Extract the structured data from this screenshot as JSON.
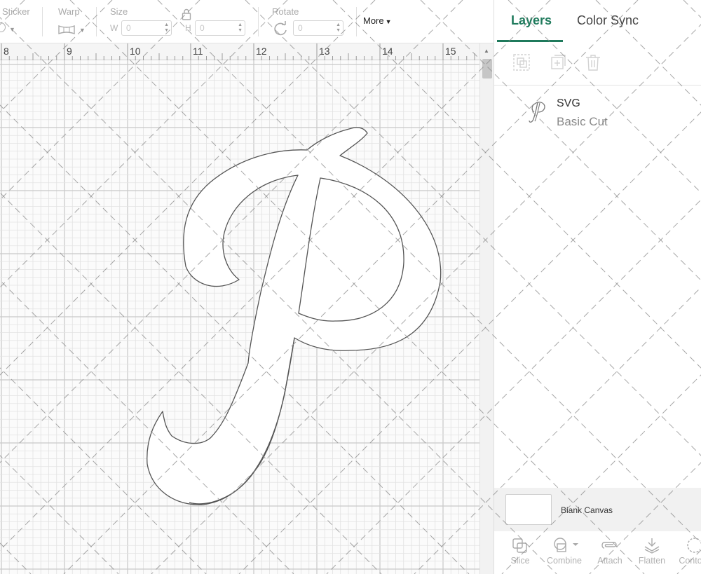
{
  "toolbar": {
    "sticker_label": "Sticker",
    "warp_label": "Warp",
    "size_label": "Size",
    "size_w_letter": "W",
    "size_w_value": "0",
    "size_h_letter": "H",
    "size_h_value": "0",
    "rotate_label": "Rotate",
    "rotate_value": "0",
    "more_label": "More"
  },
  "ruler": {
    "numbers": [
      "8",
      "9",
      "10",
      "11",
      "12",
      "13",
      "14",
      "15"
    ]
  },
  "panel": {
    "tabs": {
      "layers": "Layers",
      "color_sync": "Color Sync",
      "active": "layers"
    },
    "layer_actions": [
      "group-icon",
      "duplicate-icon",
      "delete-icon"
    ],
    "layer": {
      "name": "SVG",
      "operation": "Basic Cut",
      "thumbnail_icon": "script-p-icon"
    },
    "canvas_strip": {
      "label": "Blank Canvas"
    },
    "bottom_tools": {
      "slice": "Slice",
      "combine": "Combine",
      "attach": "Attach",
      "flatten": "Flatten",
      "contour": "Conto"
    }
  },
  "colors": {
    "accent": "#1f7a5c",
    "grid_major": "#c8c8c8",
    "grid_minor": "#e2e2e2",
    "shape_outline": "#555555",
    "watermark": "#8a8a8a"
  },
  "icons": {
    "rotate": "rotate-icon",
    "lock": "lock-icon",
    "warp": "warp-icon",
    "scroll_up": "chevron-up-icon"
  }
}
